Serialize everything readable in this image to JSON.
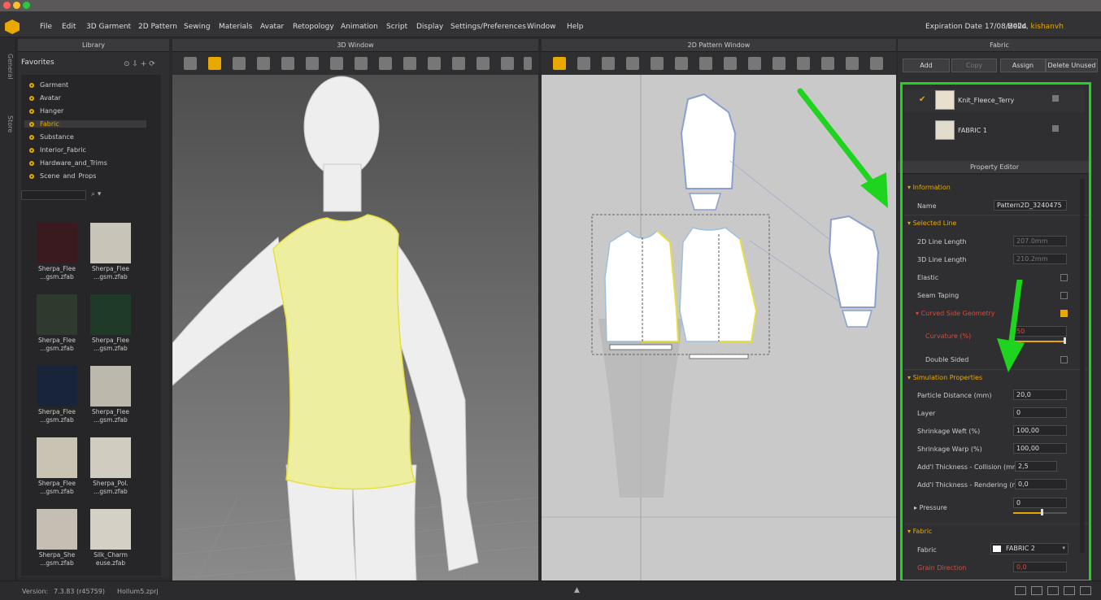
{
  "app": {
    "menus": [
      "File",
      "Edit",
      "3D Garment",
      "2D Pattern",
      "Sewing",
      "Materials",
      "Avatar",
      "Retopology",
      "Animation",
      "Script",
      "Display",
      "Settings/Preferences",
      "Window",
      "Help"
    ],
    "expiration": "Expiration Date 17/08/2024",
    "hello": "Hello, ",
    "user": "kishanvh",
    "side_tabs": [
      "General",
      "Store"
    ]
  },
  "library": {
    "title": "Library",
    "favorites_label": "Favorites",
    "favorites": [
      "Garment",
      "Avatar",
      "Hanger",
      "Fabric",
      "Substance",
      "Interior_Fabric",
      "Hardware_and_Trims",
      "Scene_and_Props"
    ],
    "selected": "Fabric",
    "items": [
      {
        "l1": "Sherpa_Flee",
        "l2": "...gsm.zfab",
        "color": "#3a1a1e"
      },
      {
        "l1": "Sherpa_Flee",
        "l2": "...gsm.zfab",
        "color": "#c9c4b8"
      },
      {
        "l1": "Sherpa_Flee",
        "l2": "...gsm.zfab",
        "color": "#2e3a2e"
      },
      {
        "l1": "Sherpa_Flee",
        "l2": "...gsm.zfab",
        "color": "#1f3a26"
      },
      {
        "l1": "Sherpa_Flee",
        "l2": "...gsm.zfab",
        "color": "#18243a"
      },
      {
        "l1": "Sherpa_Flee",
        "l2": "...gsm.zfab",
        "color": "#bdb8ac"
      },
      {
        "l1": "Sherpa_Flee",
        "l2": "...gsm.zfab",
        "color": "#c8c3b2"
      },
      {
        "l1": "Sherpa_Pol.",
        "l2": "...gsm.zfab",
        "color": "#d0ccc0"
      },
      {
        "l1": "Sherpa_She",
        "l2": "...gsm.zfab",
        "color": "#c4bfb2"
      },
      {
        "l1": "Silk_Charm",
        "l2": "euse.zfab",
        "color": "#d4d0c6"
      }
    ]
  },
  "window3d": {
    "title": "3D Window"
  },
  "window2d": {
    "title": "2D Pattern Window"
  },
  "fabric_panel": {
    "title": "Fabric",
    "buttons": [
      "Add",
      "Copy",
      "Assign",
      "Delete Unused"
    ],
    "fabrics": [
      {
        "name": "Knit_Fleece_Terry",
        "checked": true
      },
      {
        "name": "FABRIC 1",
        "checked": false
      }
    ]
  },
  "property_editor": {
    "title": "Property Editor",
    "information": {
      "section": "Information",
      "name_label": "Name",
      "name_value": "Pattern2D_3240475"
    },
    "selected_line": {
      "section": "Selected Line",
      "line2d_label": "2D Line Length",
      "line2d_value": "207.0mm",
      "line3d_label": "3D Line Length",
      "line3d_value": "210.2mm",
      "elastic_label": "Elastic",
      "seam_label": "Seam Taping",
      "curved_label": "Curved Side Geometry",
      "curvature_label": "Curvature (%)",
      "curvature_value": "50",
      "double_label": "Double Sided"
    },
    "simulation": {
      "section": "Simulation Properties",
      "rows": [
        {
          "label": "Particle Distance (mm)",
          "value": "20,0"
        },
        {
          "label": "Layer",
          "value": "0"
        },
        {
          "label": "Shrinkage Weft (%)",
          "value": "100,00"
        },
        {
          "label": "Shrinkage Warp (%)",
          "value": "100,00"
        },
        {
          "label": "Add'l Thickness - Collision (mm)",
          "value": "2,5"
        },
        {
          "label": "Add'l Thickness - Rendering (mm)",
          "value": "0,0"
        }
      ],
      "pressure_label": "Pressure",
      "pressure_value": "0"
    },
    "fabric": {
      "section": "Fabric",
      "fabric_label": "Fabric",
      "fabric_value": "FABRIC 2",
      "grain_label": "Grain Direction",
      "grain_value": "0,0"
    }
  },
  "status": {
    "version_label": "Version:",
    "version_value": "7.3.83 (r45759)",
    "file": "Hollum5.zprj"
  },
  "colors": {
    "accent": "#e8a800",
    "annotation": "#1ed41e",
    "garment": "#eeeea0"
  }
}
